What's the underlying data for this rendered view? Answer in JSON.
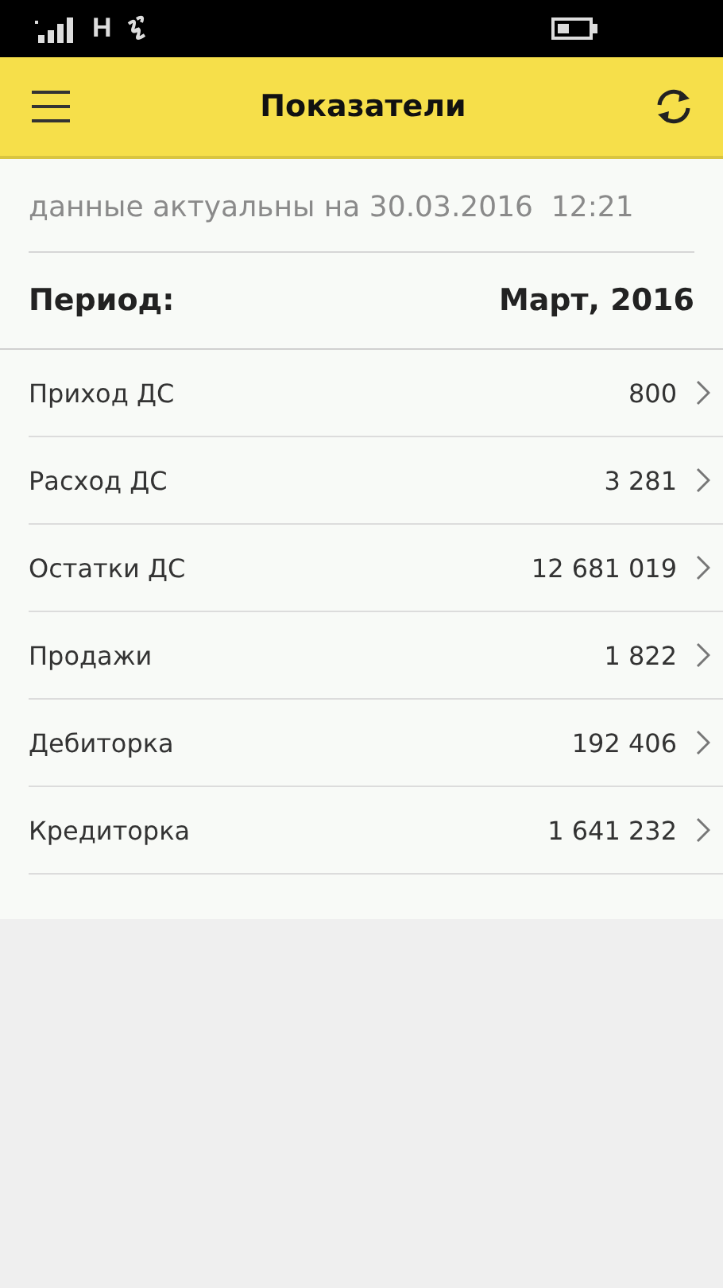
{
  "status_bar": {
    "network": "H"
  },
  "header": {
    "title": "Показатели"
  },
  "updated": "данные актуальны на 30.03.2016  12:21",
  "period": {
    "label": "Период:",
    "value": "Март, 2016"
  },
  "rows": [
    {
      "label": "Приход ДС",
      "value": "800"
    },
    {
      "label": "Расход ДС",
      "value": "3 281"
    },
    {
      "label": "Остатки ДС",
      "value": "12 681 019"
    },
    {
      "label": "Продажи",
      "value": "1 822"
    },
    {
      "label": "Дебиторка",
      "value": "192 406"
    },
    {
      "label": "Кредиторка",
      "value": "1 641 232"
    }
  ]
}
